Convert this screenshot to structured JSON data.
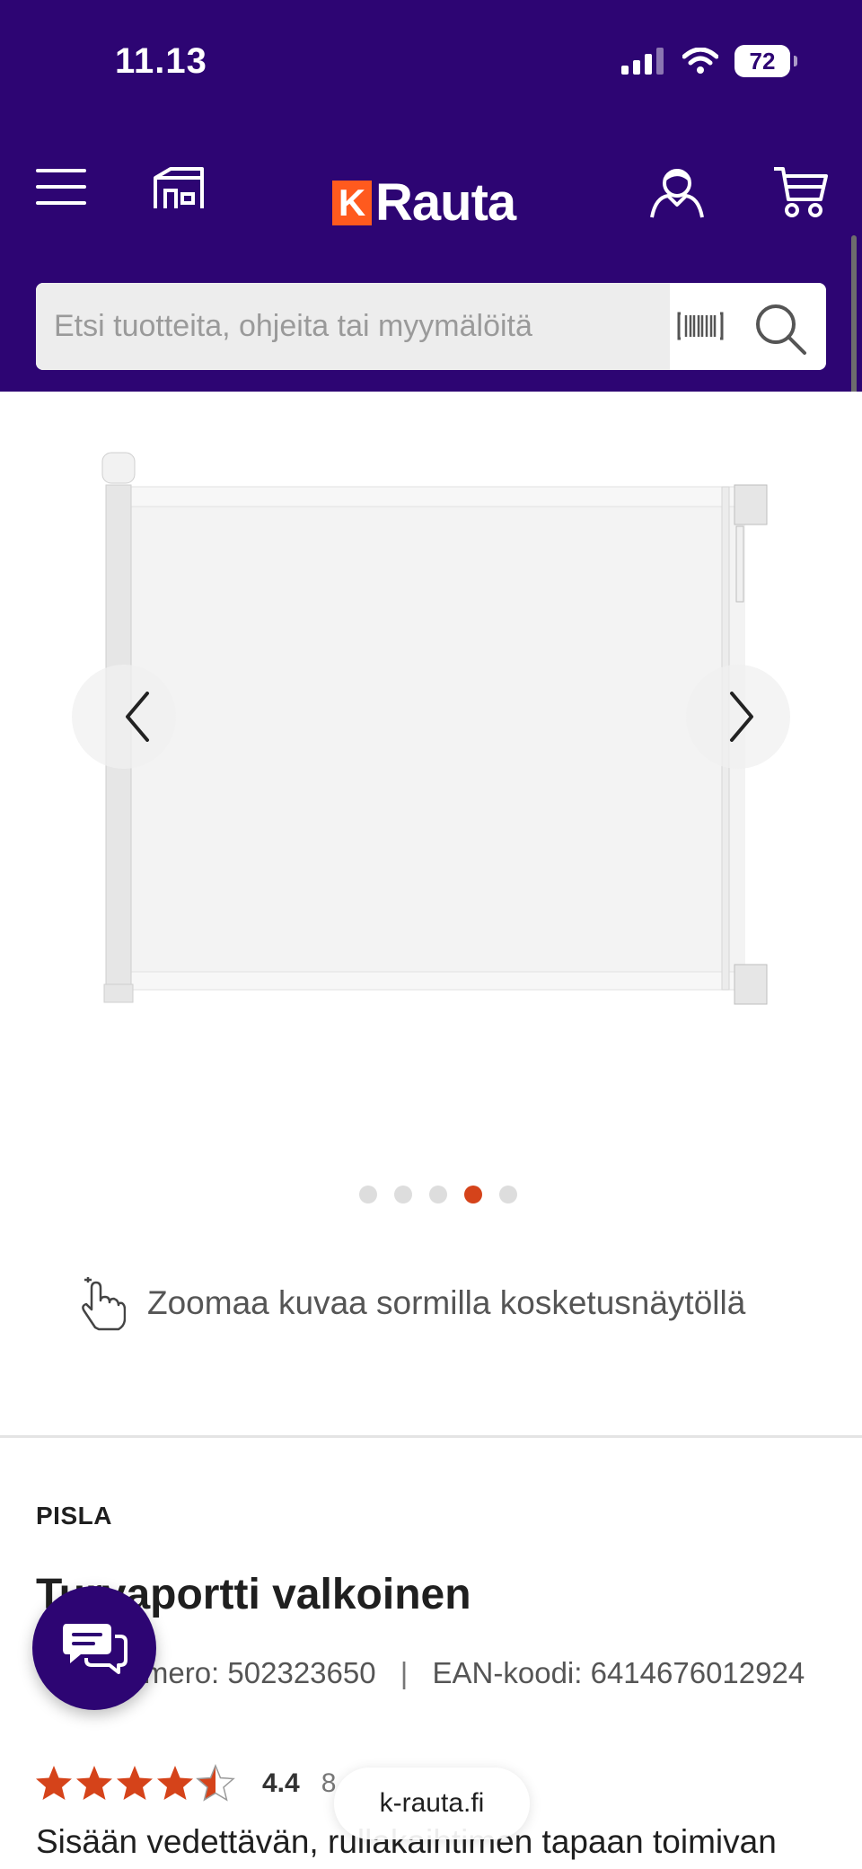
{
  "status_bar": {
    "time": "11.13",
    "battery": "72"
  },
  "header": {
    "logo_k": "K",
    "logo_text": "Rauta",
    "colors": {
      "background": "#2d0573",
      "brand_orange": "#ff5a1e"
    },
    "icons": [
      "menu-icon",
      "store-icon",
      "user-icon",
      "cart-icon"
    ]
  },
  "search": {
    "placeholder": "Etsi tuotteita, ohjeita tai myymälöitä",
    "icons": [
      "barcode-scan-icon",
      "search-icon"
    ]
  },
  "gallery": {
    "image_count": 5,
    "active_index": 4,
    "zoom_hint": "Zoomaa kuvaa sormilla kosketusnäytöllä",
    "accent": "#d5431a"
  },
  "product": {
    "brand": "PISLA",
    "title": "Turvaportti valkoinen",
    "product_number_label": "Tuotenumero:",
    "product_number": "502323650",
    "ean_label": "EAN-koodi:",
    "ean": "6414676012924",
    "rating_value": "4.4",
    "rating_fraction": 0.88,
    "rating_count": "8",
    "description": "Sisään vedettävän, rullakaihtimen tapaan toimivan"
  },
  "browser": {
    "url": "k-rauta.fi"
  }
}
